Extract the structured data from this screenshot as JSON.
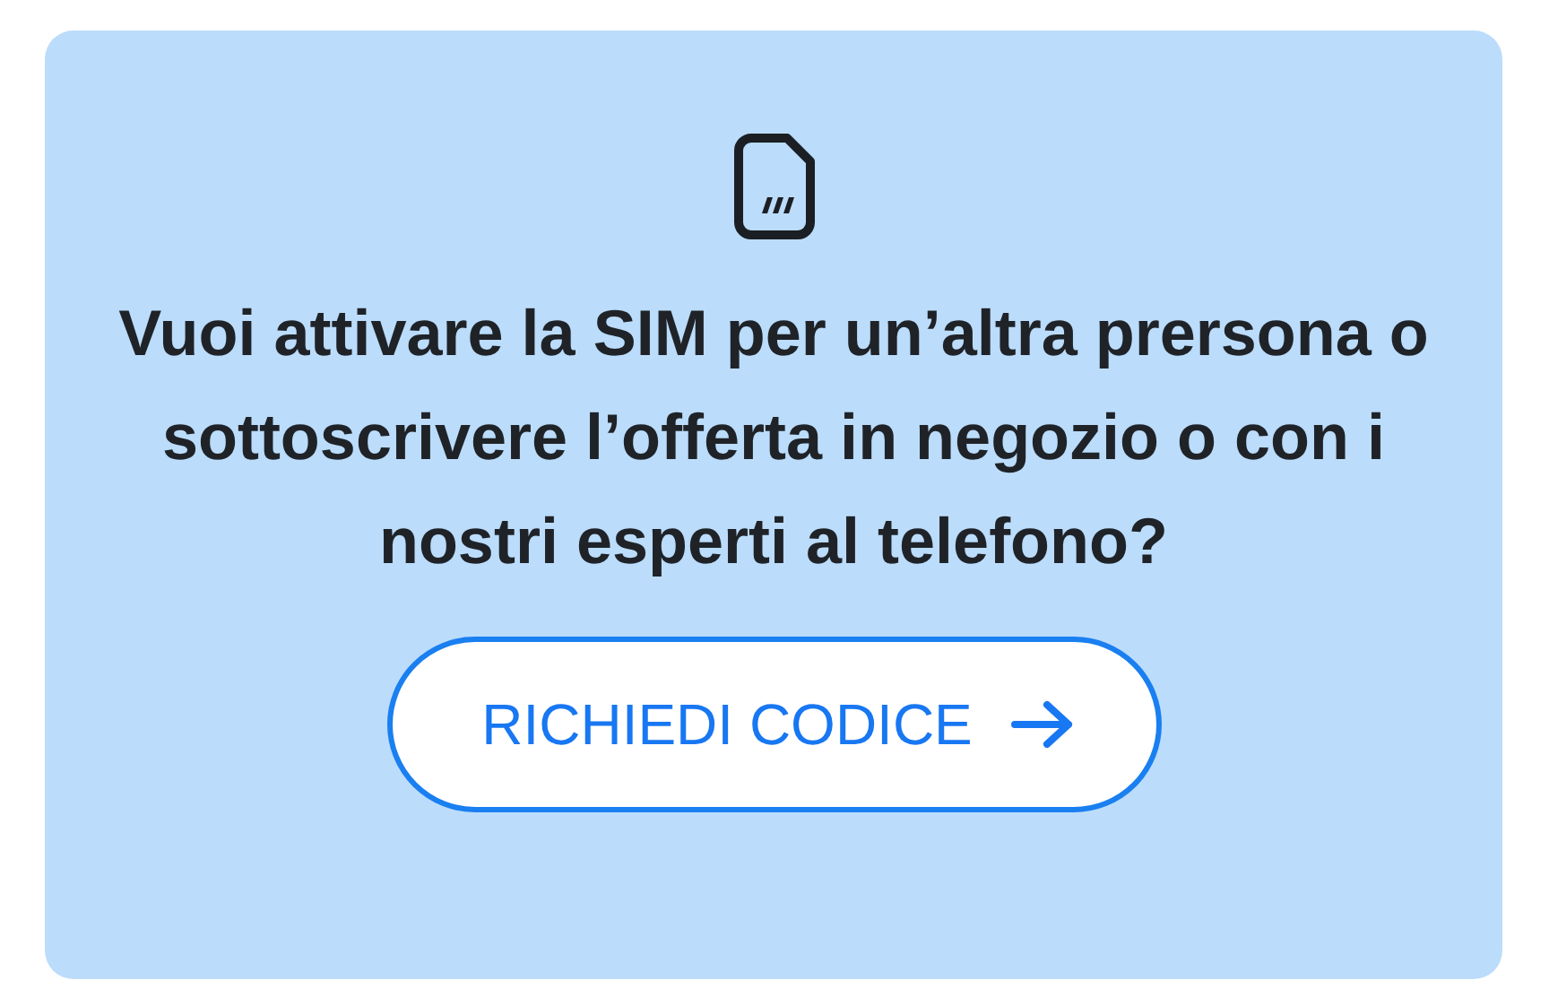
{
  "card": {
    "question": "Vuoi attivare la SIM per un’altra prersona o sottoscrivere l’offerta in negozio o con i nostri esperti al telefono?",
    "button": {
      "label": "RICHIEDI CODICE"
    }
  }
}
